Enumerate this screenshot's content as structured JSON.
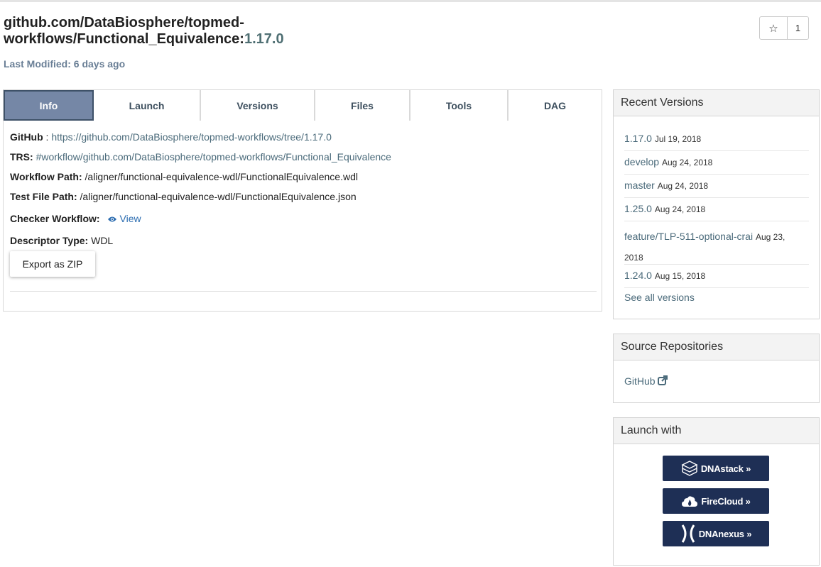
{
  "header": {
    "title_path": "github.com/DataBiosphere/topmed-workflows/Functional_Equivalence:",
    "title_line1": "github.com/DataBiosphere/topmed-",
    "title_line2": "workflows/Functional_Equivalence:",
    "version": "1.17.0",
    "last_modified_label": "Last Modified:",
    "last_modified_value": "6 days ago",
    "star_icon": "star-icon",
    "star_count": "1"
  },
  "tabs": [
    {
      "label": "Info",
      "active": true
    },
    {
      "label": "Launch"
    },
    {
      "label": "Versions"
    },
    {
      "label": "Files"
    },
    {
      "label": "Tools"
    },
    {
      "label": "DAG"
    }
  ],
  "info": {
    "github_label": "GitHub",
    "github_sep": " : ",
    "github_url": "https://github.com/DataBiosphere/topmed-workflows/tree/1.17.0",
    "trs_label": "TRS:",
    "trs_value": "#workflow/github.com/DataBiosphere/topmed-workflows/Functional_Equivalence",
    "workflow_path_label": "Workflow Path:",
    "workflow_path_value": "/aligner/functional-equivalence-wdl/FunctionalEquivalence.wdl",
    "test_file_label": "Test File Path:",
    "test_file_value": "/aligner/functional-equivalence-wdl/FunctionalEquivalence.json",
    "checker_label": "Checker Workflow:",
    "checker_link": "View",
    "descriptor_label": "Descriptor Type:",
    "descriptor_value": "WDL",
    "export_button": "Export as ZIP"
  },
  "recent_versions": {
    "title": "Recent Versions",
    "items": [
      {
        "name": "1.17.0",
        "date": "Jul 19, 2018"
      },
      {
        "name": "develop",
        "date": "Aug 24, 2018"
      },
      {
        "name": "master",
        "date": "Aug 24, 2018"
      },
      {
        "name": "1.25.0",
        "date": "Aug 24, 2018"
      },
      {
        "name": "feature/TLP-511-optional-crai",
        "date": "Aug 23,",
        "date_line2": "2018"
      },
      {
        "name": "1.24.0",
        "date": "Aug 15, 2018"
      }
    ],
    "see_all": "See all versions"
  },
  "source_repos": {
    "title": "Source Repositories",
    "github": "GitHub",
    "icon": "external-link-icon"
  },
  "launch_with": {
    "title": "Launch with",
    "buttons": [
      {
        "label": "DNAstack »",
        "icon": "dnastack-logo-icon"
      },
      {
        "label": "FireCloud »",
        "icon": "firecloud-logo-icon"
      },
      {
        "label": "DNAnexus »",
        "icon": "dnanexus-logo-icon"
      }
    ]
  },
  "colors": {
    "active_tab": "#7587a6",
    "link": "#4a6a7a",
    "launch_button": "#1e2f55"
  }
}
